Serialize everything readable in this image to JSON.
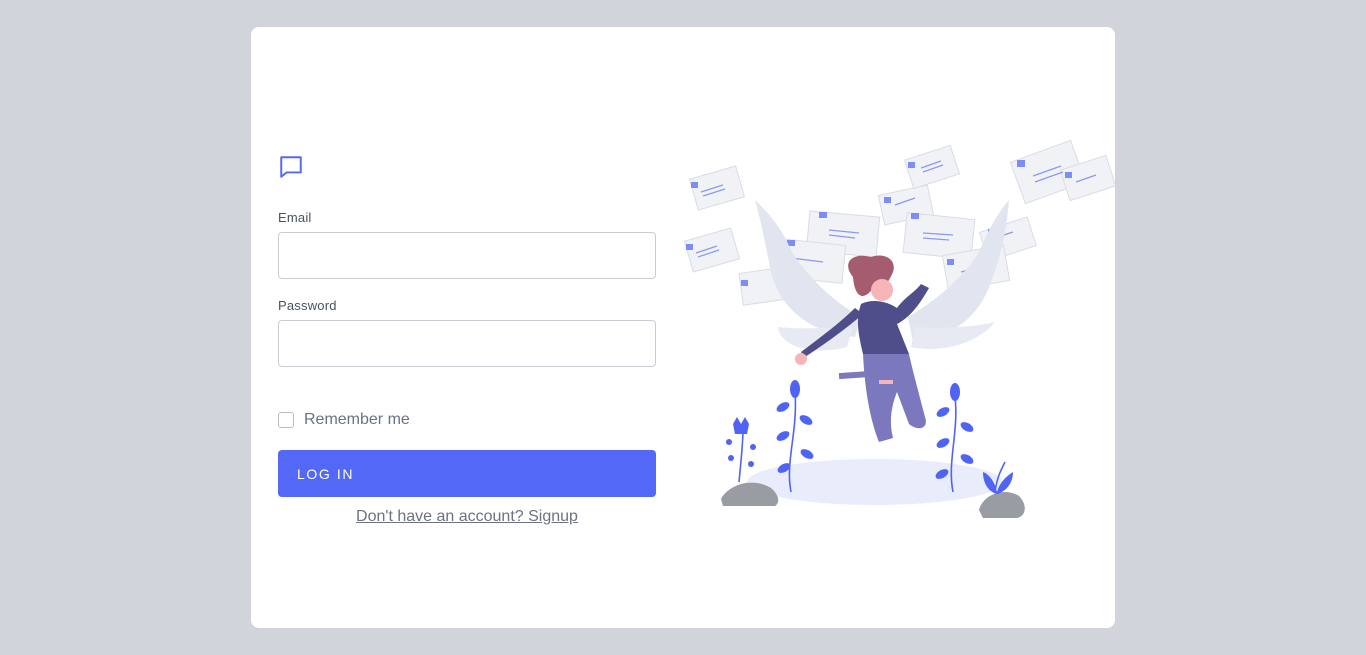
{
  "form": {
    "email_label": "Email",
    "email_value": "",
    "password_label": "Password",
    "password_value": "",
    "remember_label": "Remember me",
    "remember_checked": false,
    "login_label": "LOG IN",
    "signup_text": "Don't have an account? Signup"
  },
  "icons": {
    "logo": "message-square-icon",
    "illustration": "jumping-woman-with-wings-and-envelopes"
  },
  "colors": {
    "accent": "#5468f8",
    "background": "#d1d4db",
    "card": "#ffffff"
  }
}
